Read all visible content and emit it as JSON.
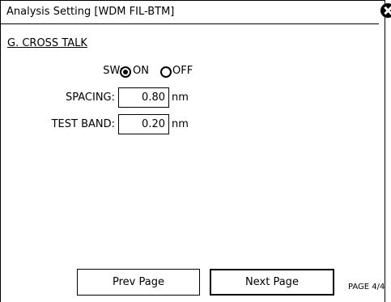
{
  "window": {
    "title": "Analysis Setting [WDM FIL-BTM]"
  },
  "section": {
    "title": "G. CROSS TALK"
  },
  "sw": {
    "label": "SW:",
    "options": [
      {
        "label": "ON",
        "selected": true
      },
      {
        "label": "OFF",
        "selected": false
      }
    ]
  },
  "spacing": {
    "label": "SPACING:",
    "value": "0.80",
    "unit": "nm"
  },
  "test_band": {
    "label": "TEST BAND:",
    "value": "0.20",
    "unit": "nm"
  },
  "buttons": {
    "prev": "Prev Page",
    "next": "Next Page"
  },
  "page_indicator": "PAGE 4/4",
  "icons": {
    "close": "close-icon"
  }
}
